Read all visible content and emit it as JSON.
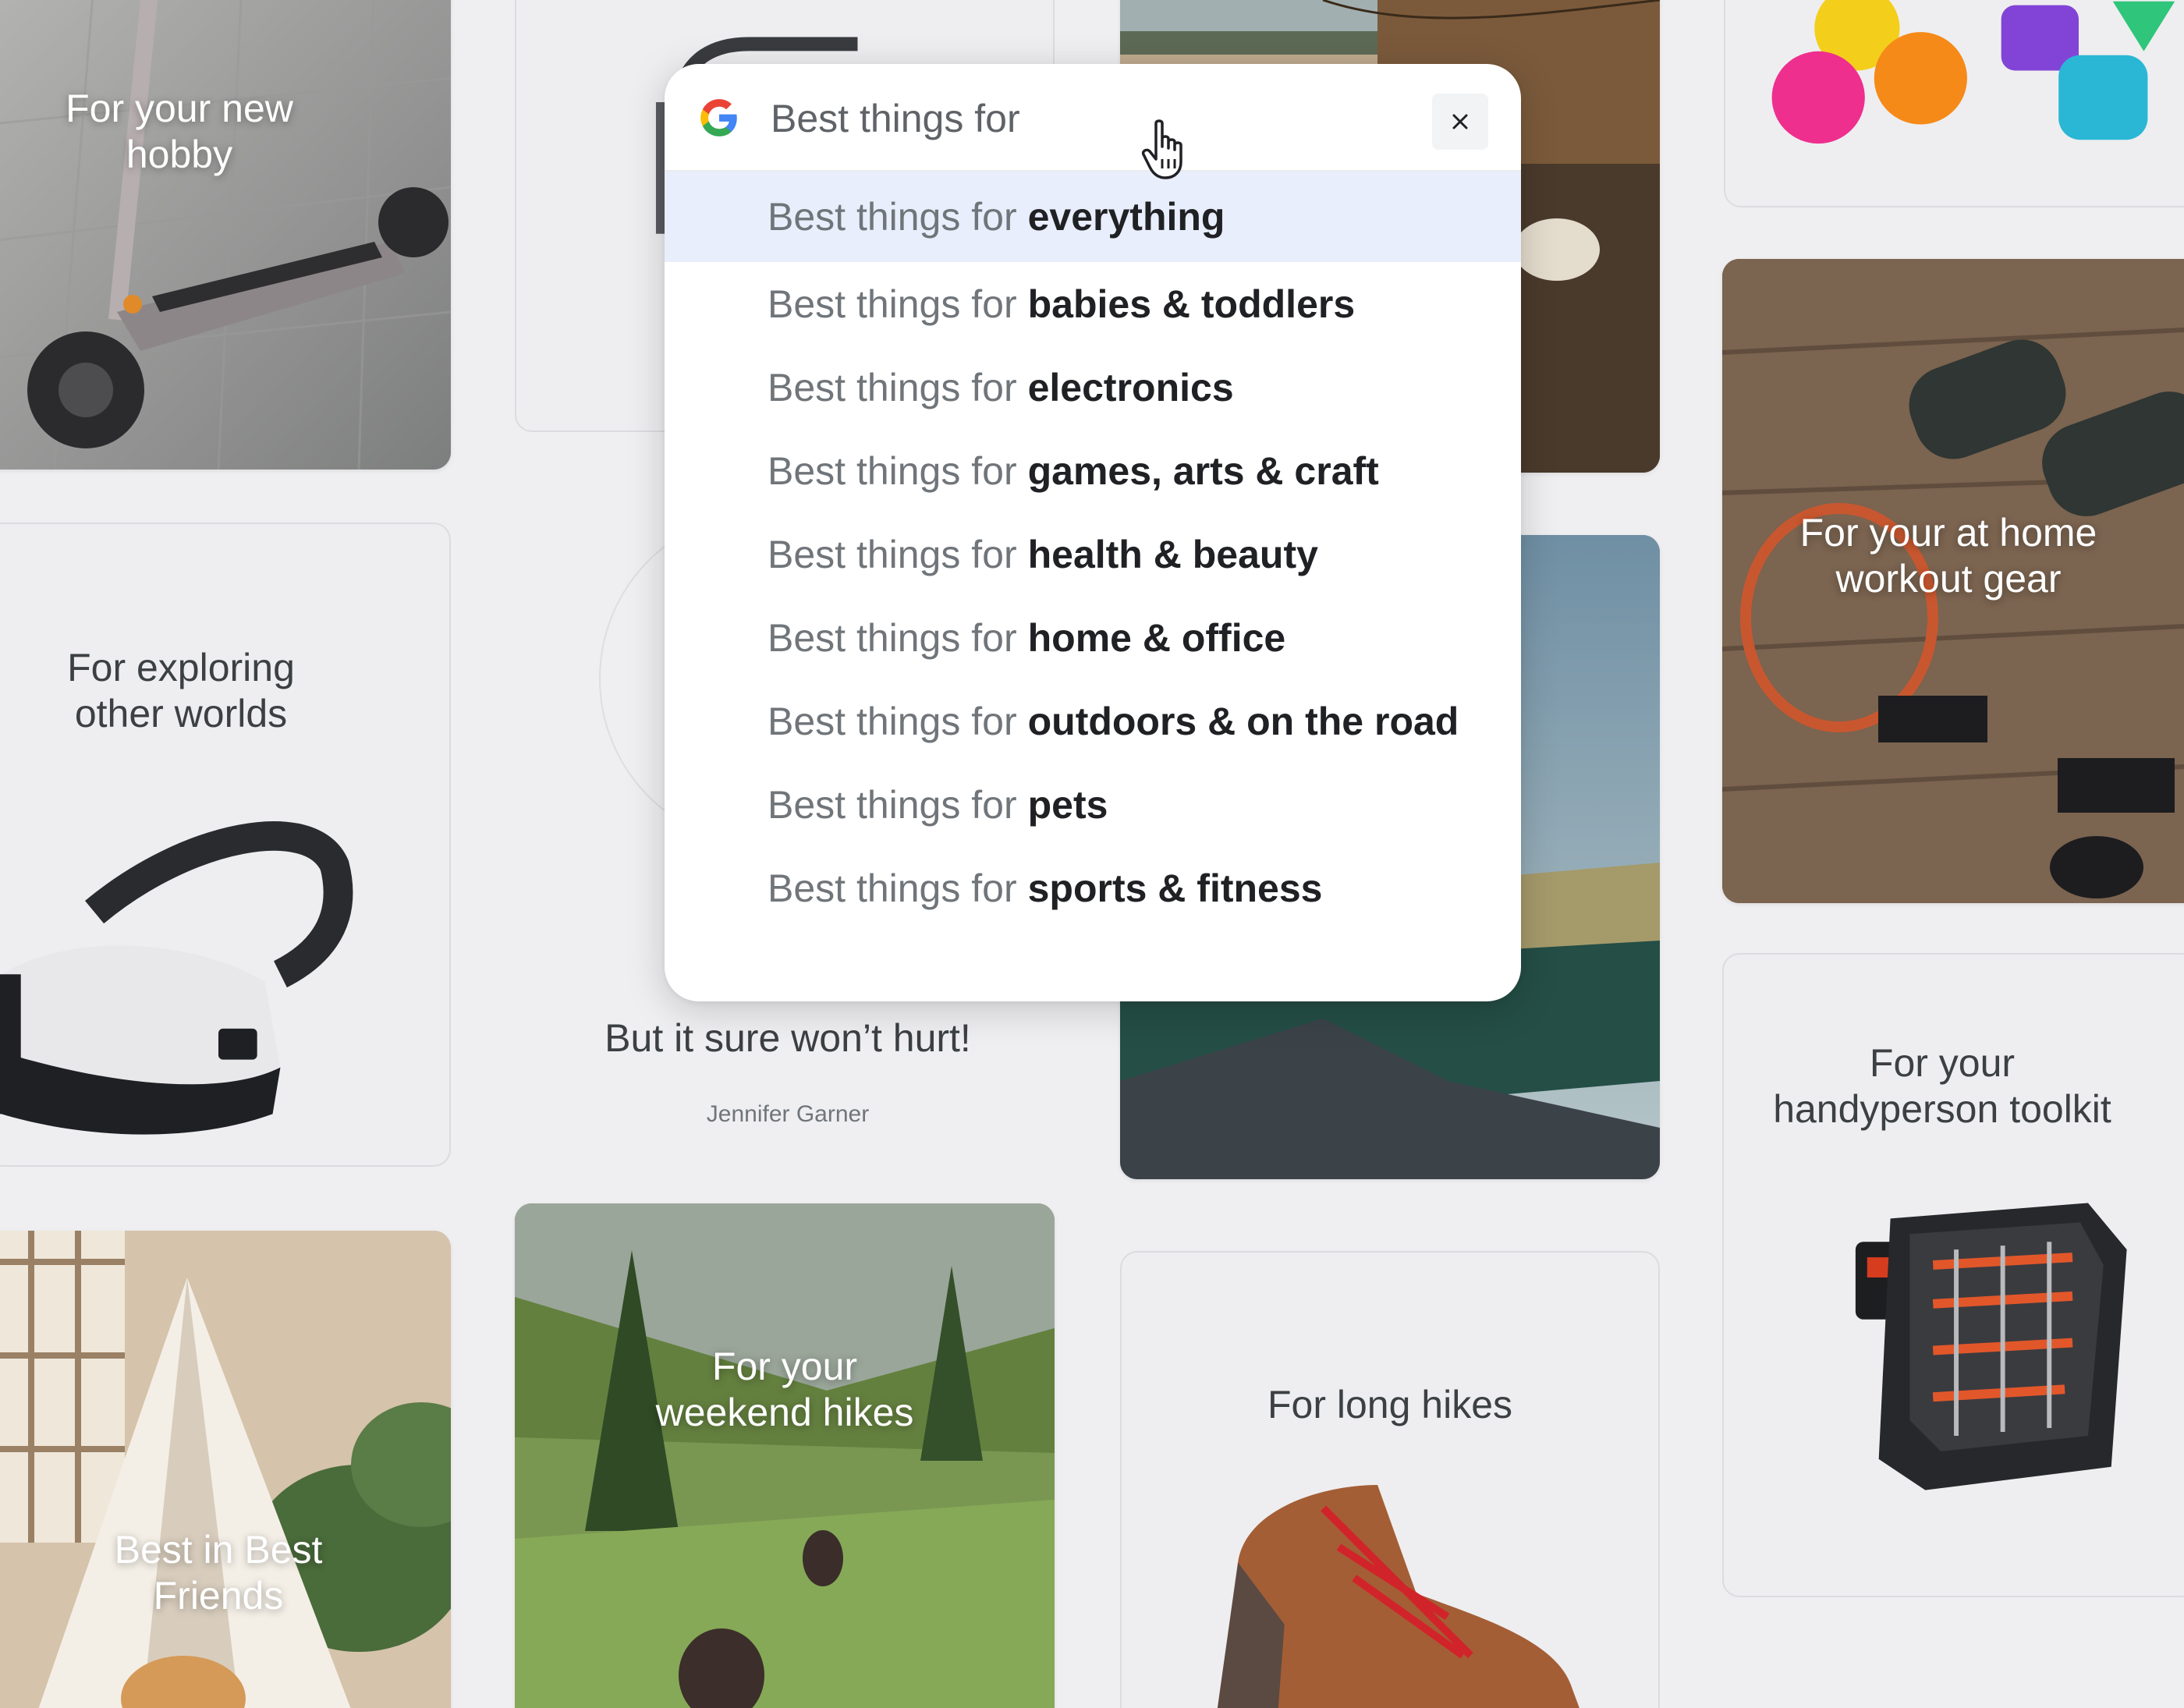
{
  "tiles": {
    "new_hobby": "For your new\nhobby",
    "exploring": "For exploring\nother worlds",
    "best_friends": "Best in Best\nFriends",
    "weekend_hikes": "For your\nweekend hikes",
    "long_hikes": "For long hikes",
    "workout": "For your at home\nworkout gear",
    "handyperson": "For your\nhandyperson toolkit"
  },
  "quote": {
    "text": "Having t                            \nwon’t ma                            \nBut it sure won’t hurt!",
    "author": "Jennifer Garner"
  },
  "search": {
    "query": "Best things for",
    "close_label": "×",
    "suggestions": [
      {
        "prefix": "Best things for",
        "term": "everything"
      },
      {
        "prefix": "Best things for",
        "term": "babies & toddlers"
      },
      {
        "prefix": "Best things for",
        "term": "electronics"
      },
      {
        "prefix": "Best things for",
        "term": "games, arts & craft"
      },
      {
        "prefix": "Best things for",
        "term": "health & beauty"
      },
      {
        "prefix": "Best things for",
        "term": "home & office"
      },
      {
        "prefix": "Best things for",
        "term": "outdoors & on the road"
      },
      {
        "prefix": "Best things for",
        "term": "pets"
      },
      {
        "prefix": "Best things for",
        "term": "sports & fitness"
      }
    ]
  },
  "colors": {
    "highlight": "#e8eefb",
    "google_blue": "#4285F4",
    "google_red": "#EA4335",
    "google_yellow": "#FBBC05",
    "google_green": "#34A853"
  }
}
